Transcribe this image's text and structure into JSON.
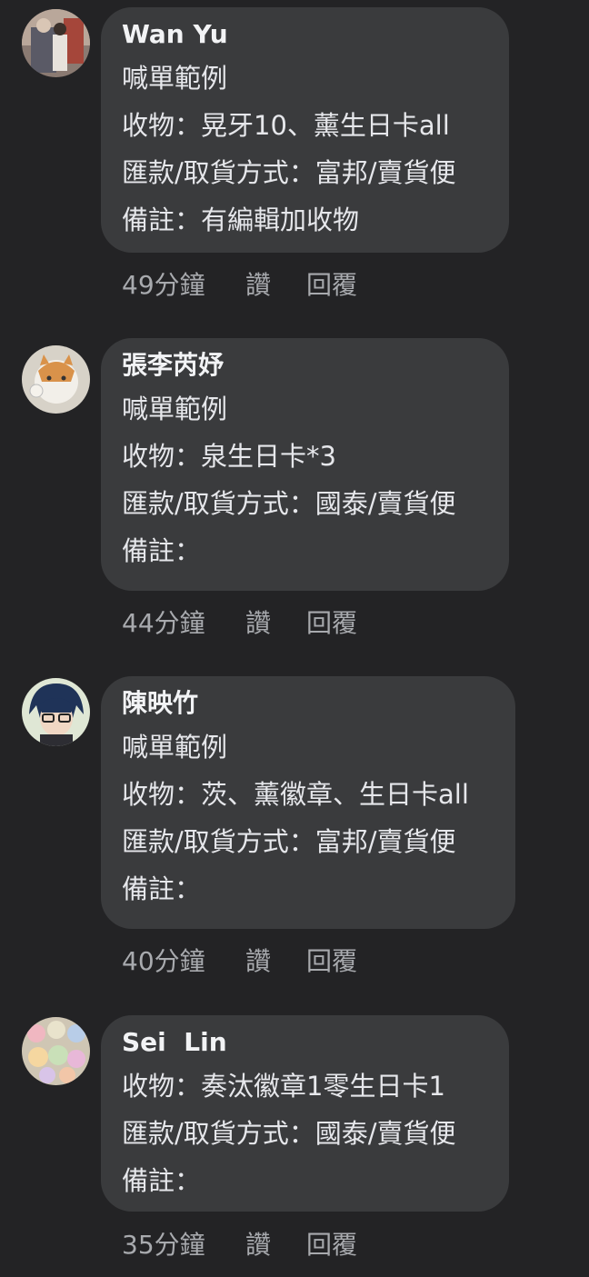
{
  "comments": [
    {
      "author": "Wan Yu",
      "lines": [
        "喊單範例",
        "收物：晃牙10、薰生日卡all",
        "匯款/取貨方式：富邦/賣貨便",
        "備註：有編輯加收物"
      ],
      "time": "49分鐘",
      "like": "讚",
      "reply": "回覆"
    },
    {
      "author": "張李芮妤",
      "lines": [
        "喊單範例",
        "收物：泉生日卡*3",
        "匯款/取貨方式：國泰/賣貨便",
        "備註："
      ],
      "time": "44分鐘",
      "like": "讚",
      "reply": "回覆"
    },
    {
      "author": "陳映竹",
      "lines": [
        "喊單範例",
        "收物：茨、薰徽章、生日卡all",
        "匯款/取貨方式：富邦/賣貨便",
        "備註："
      ],
      "time": "40分鐘",
      "like": "讚",
      "reply": "回覆"
    },
    {
      "author": "Sei  Lin",
      "lines": [
        "收物：奏汰徽章1零生日卡1",
        "匯款/取貨方式：國泰/賣貨便",
        "備註："
      ],
      "time": "35分鐘",
      "like": "讚",
      "reply": "回覆"
    }
  ]
}
